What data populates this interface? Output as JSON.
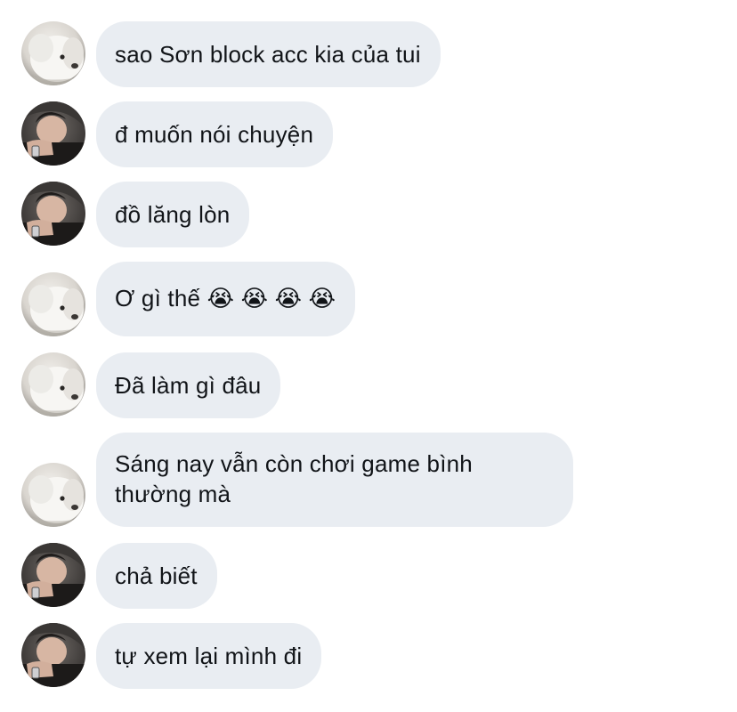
{
  "conversation": {
    "messages": [
      {
        "sender": "dog",
        "text": "sao Sơn block acc kia của tui"
      },
      {
        "sender": "man",
        "text": "đ muốn nói chuyện"
      },
      {
        "sender": "man",
        "text": "đồ lăng lòn"
      },
      {
        "sender": "dog",
        "text": "Ơ gì thế 😭 😭 😭 😭"
      },
      {
        "sender": "dog",
        "text": "Đã làm gì đâu"
      },
      {
        "sender": "dog",
        "text": "Sáng nay vẫn còn chơi game bình thường mà"
      },
      {
        "sender": "man",
        "text": "chả biết"
      },
      {
        "sender": "man",
        "text": "tự xem lại mình đi"
      }
    ]
  },
  "colors": {
    "bubble_background": "#e9edf2",
    "text": "#111418",
    "background": "#ffffff"
  }
}
